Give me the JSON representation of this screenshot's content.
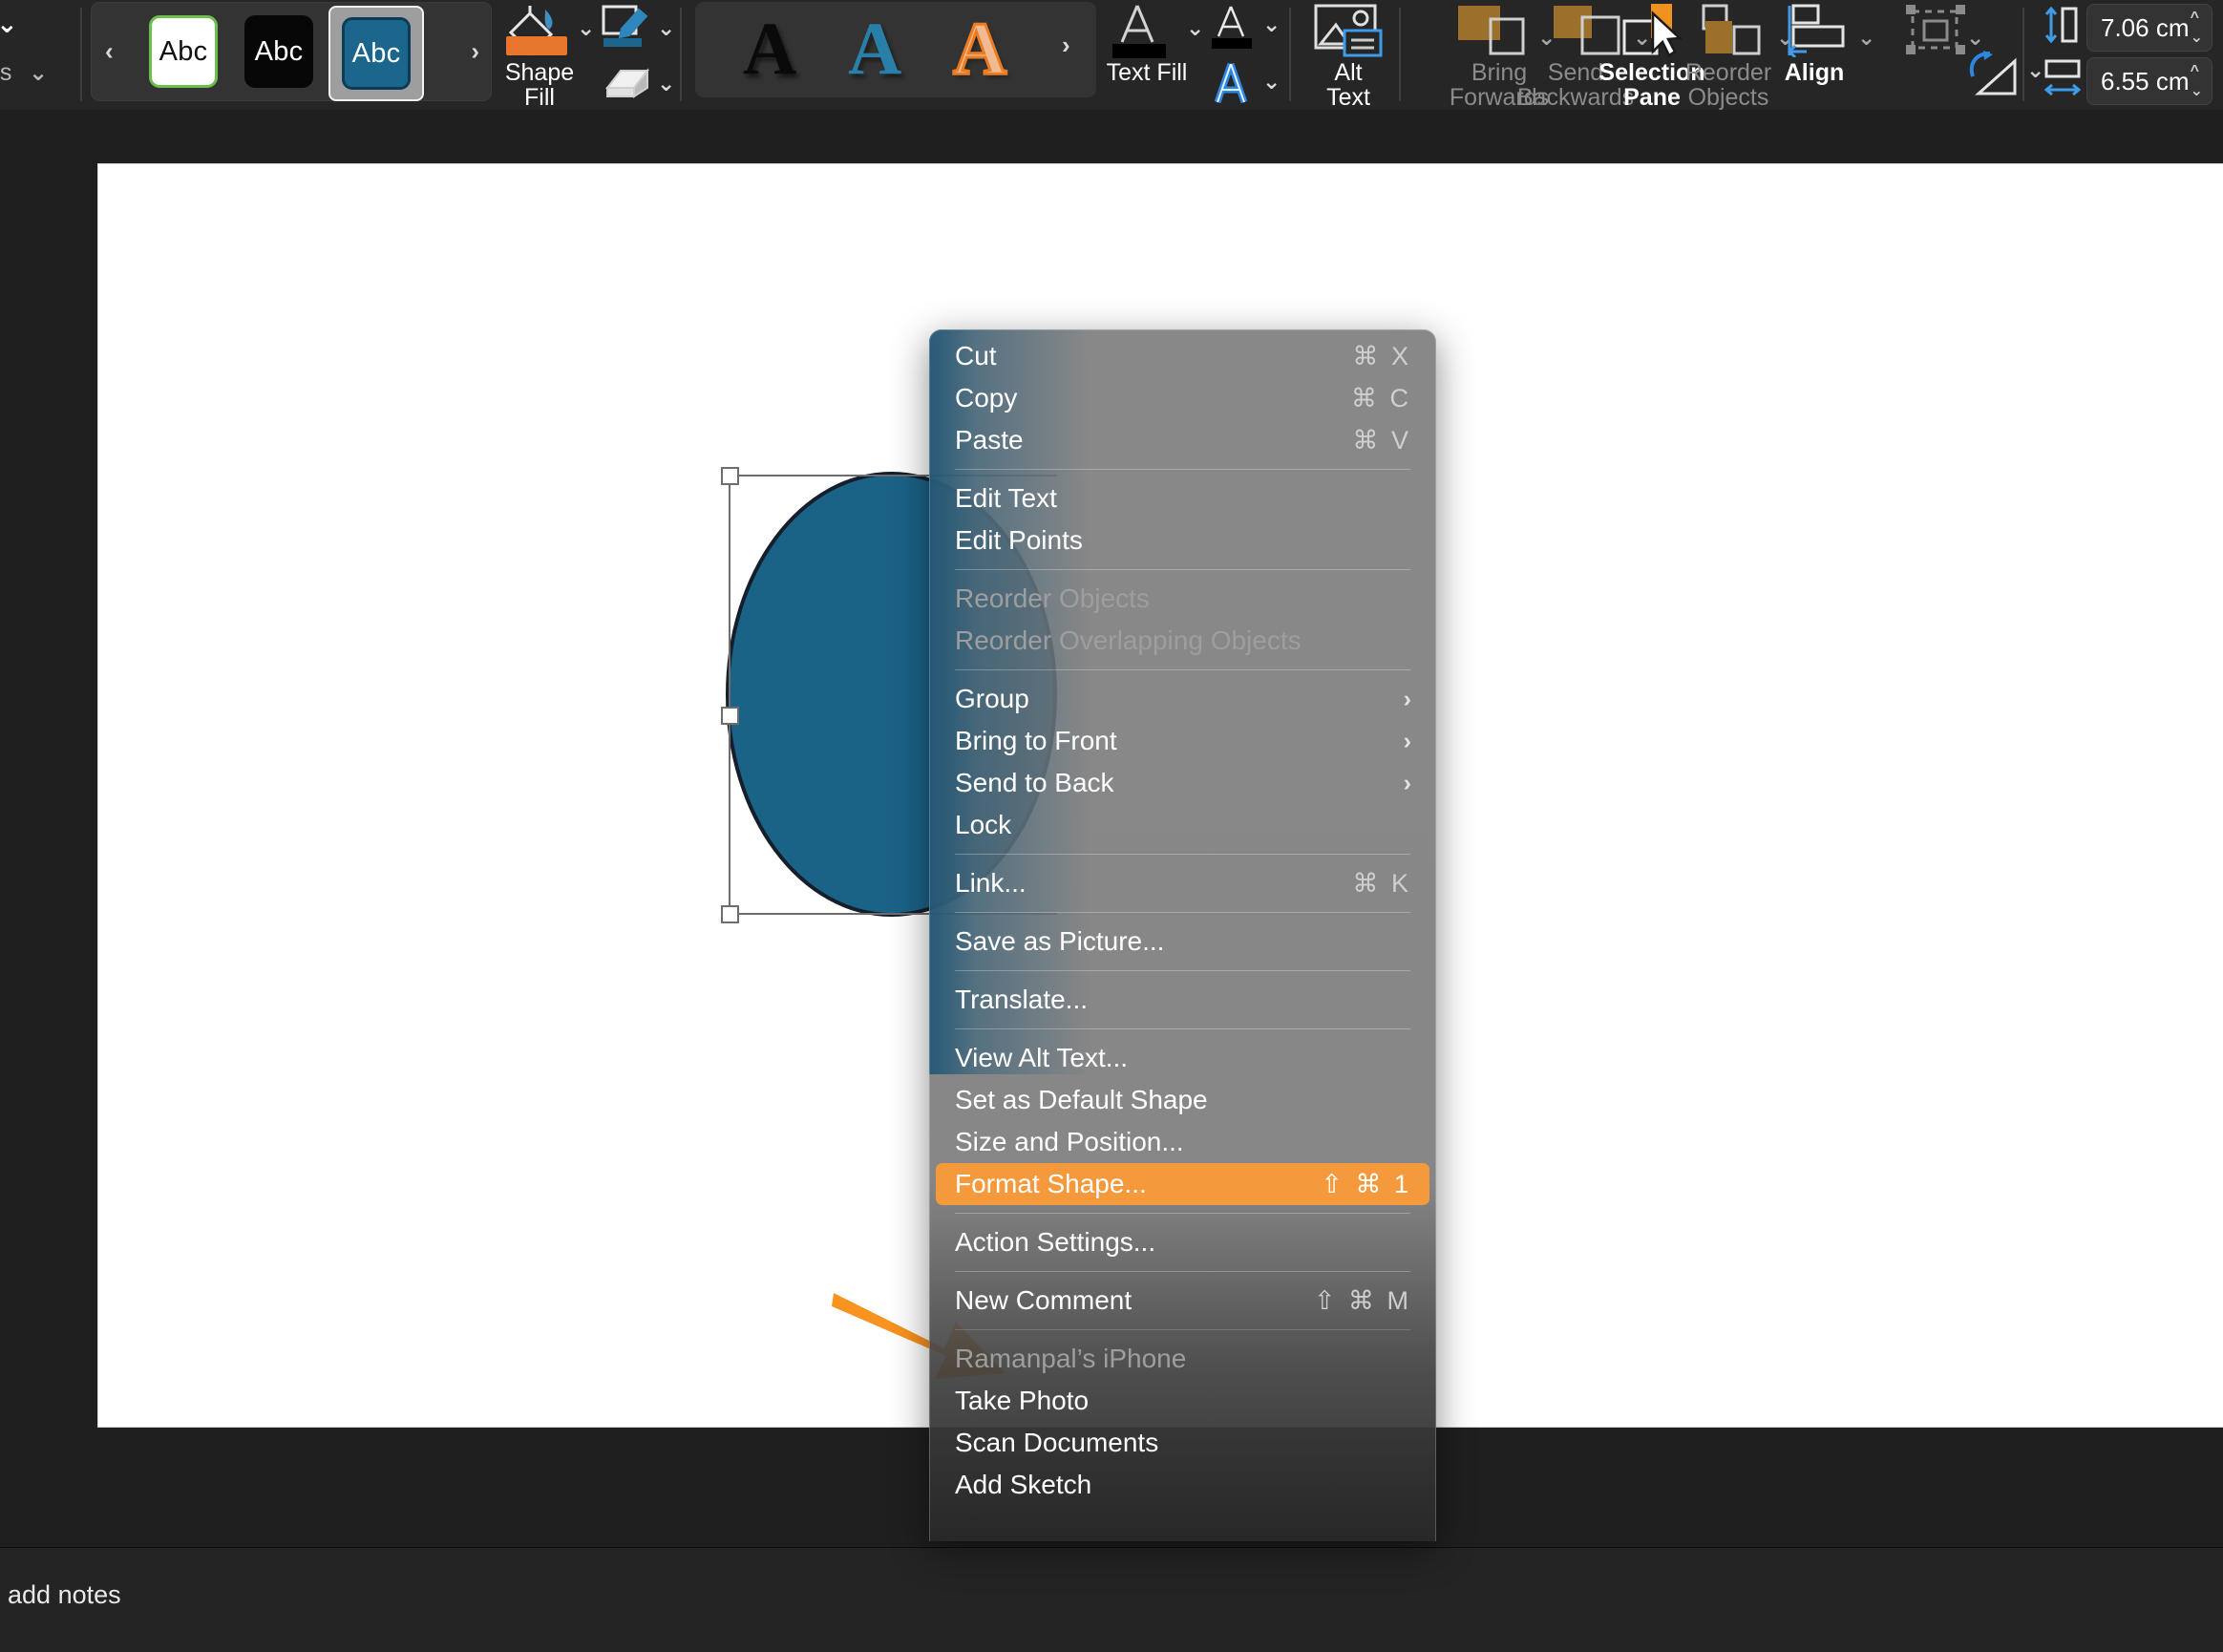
{
  "app": "PowerPoint for Mac — Shape Format ribbon with context menu",
  "ribbon": {
    "left_partial": {
      "label": "es",
      "chevron": "chevron-down"
    },
    "shape_styles": {
      "prev": "‹",
      "next": "›",
      "swatches": [
        {
          "text": "Abc",
          "fill": "#ffffff",
          "outline": "#6cbf4b",
          "selected": false
        },
        {
          "text": "Abc",
          "fill": "#070707",
          "outline": "#070707",
          "selected": false
        },
        {
          "text": "Abc",
          "fill": "#1c658c",
          "outline": "#0d3c56",
          "selected": true
        }
      ]
    },
    "shape_fill": {
      "label_line1": "Shape",
      "label_line2": "Fill",
      "current_color": "#e8762c",
      "chevron": "⌄"
    },
    "shape_outline": {
      "name": "Shape Outline",
      "current_color": "#1c658c",
      "chevron": "⌄"
    },
    "shape_effects": {
      "name": "Shape Effects",
      "chevron": "⌄"
    },
    "wordart_styles": {
      "next": "›",
      "items": [
        {
          "glyph": "A",
          "color": "#0a0a0a"
        },
        {
          "glyph": "A",
          "color": "#2a7fa8"
        },
        {
          "glyph": "A",
          "color": "#f0bb93"
        }
      ]
    },
    "text_fill": {
      "label": "Text Fill",
      "current_color": "#000000",
      "chevron": "⌄"
    },
    "text_outline": {
      "name": "Text Outline",
      "chevron": "⌄"
    },
    "text_effects": {
      "name": "Text Effects",
      "chevron": "⌄"
    },
    "alt_text": {
      "line1": "Alt",
      "line2": "Text"
    },
    "arrange": [
      {
        "line1": "Bring",
        "line2": "Forwards",
        "enabled": false,
        "chevron": "⌄"
      },
      {
        "line1": "Send",
        "line2": "Backwards",
        "enabled": false,
        "chevron": "⌄"
      },
      {
        "line1": "Selection",
        "line2": "Pane",
        "enabled": true,
        "chevron": ""
      },
      {
        "line1": "Reorder",
        "line2": "Objects",
        "enabled": false,
        "chevron": "⌄"
      },
      {
        "line1": "Align",
        "line2": "",
        "enabled": true,
        "chevron": "⌄"
      },
      {
        "line1": "",
        "line2": "",
        "enabled": false,
        "chevron": "⌄"
      }
    ],
    "size": {
      "height": {
        "value": "7.06 cm",
        "icon": "shape-height-icon"
      },
      "width": {
        "value": "6.55 cm",
        "icon": "shape-width-icon"
      }
    }
  },
  "canvas": {
    "shape": {
      "type": "oval",
      "fill": "#1b6287",
      "outline": "#141f2b",
      "selected": true
    },
    "annotation_arrow": {
      "color": "#f7931e"
    }
  },
  "notes_bar": {
    "text": "to add notes"
  },
  "context_menu": {
    "groups": [
      {
        "items": [
          {
            "label": "Cut",
            "shortcut": "⌘ X",
            "enabled": true
          },
          {
            "label": "Copy",
            "shortcut": "⌘ C",
            "enabled": true
          },
          {
            "label": "Paste",
            "shortcut": "⌘ V",
            "enabled": true
          }
        ]
      },
      {
        "items": [
          {
            "label": "Edit Text",
            "shortcut": "",
            "enabled": true
          },
          {
            "label": "Edit Points",
            "shortcut": "",
            "enabled": true
          }
        ]
      },
      {
        "items": [
          {
            "label": "Reorder Objects",
            "shortcut": "",
            "enabled": false
          },
          {
            "label": "Reorder Overlapping Objects",
            "shortcut": "",
            "enabled": false
          }
        ]
      },
      {
        "items": [
          {
            "label": "Group",
            "submenu": "›",
            "enabled": true
          },
          {
            "label": "Bring to Front",
            "submenu": "›",
            "enabled": true
          },
          {
            "label": "Send to Back",
            "submenu": "›",
            "enabled": true
          },
          {
            "label": "Lock",
            "shortcut": "",
            "enabled": true
          }
        ]
      },
      {
        "items": [
          {
            "label": "Link...",
            "shortcut": "⌘ K",
            "enabled": true
          }
        ]
      },
      {
        "items": [
          {
            "label": "Save as Picture...",
            "shortcut": "",
            "enabled": true
          }
        ]
      },
      {
        "items": [
          {
            "label": "Translate...",
            "shortcut": "",
            "enabled": true
          }
        ]
      },
      {
        "items": [
          {
            "label": "View Alt Text...",
            "shortcut": "",
            "enabled": true
          },
          {
            "label": "Set as Default Shape",
            "shortcut": "",
            "enabled": true
          },
          {
            "label": "Size and Position...",
            "shortcut": "",
            "enabled": true
          },
          {
            "label": "Format Shape...",
            "shortcut": "⇧ ⌘ 1",
            "enabled": true,
            "highlighted": true
          }
        ]
      },
      {
        "items": [
          {
            "label": "Action Settings...",
            "shortcut": "",
            "enabled": true
          }
        ]
      },
      {
        "items": [
          {
            "label": "New Comment",
            "shortcut": "⇧ ⌘ M",
            "enabled": true
          }
        ]
      },
      {
        "items": [
          {
            "label": "Ramanpal’s iPhone",
            "shortcut": "",
            "enabled": false
          },
          {
            "label": "Take Photo",
            "shortcut": "",
            "enabled": true
          },
          {
            "label": "Scan Documents",
            "shortcut": "",
            "enabled": true
          },
          {
            "label": "Add Sketch",
            "shortcut": "",
            "enabled": true
          }
        ]
      }
    ],
    "highlight_color": "#f59a3c"
  }
}
